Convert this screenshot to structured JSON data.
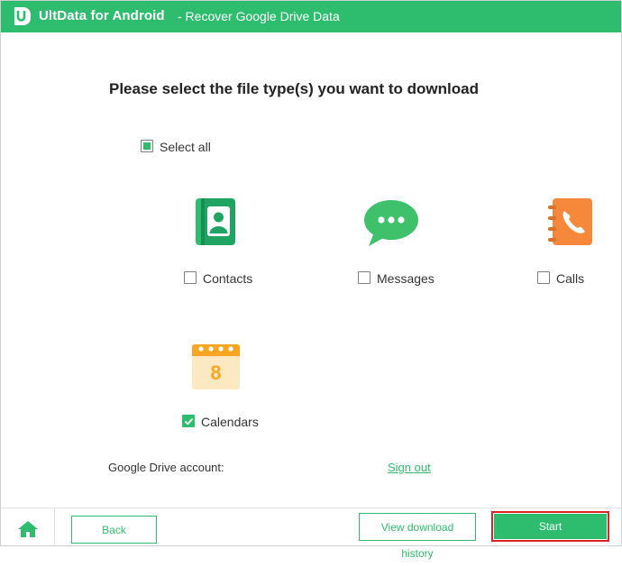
{
  "window": {
    "app_name": "UltData for Android",
    "subtitle": "- Recover Google Drive Data"
  },
  "main": {
    "heading": "Please select the file type(s) you want to download",
    "select_all": {
      "label": "Select all",
      "state": "partial"
    },
    "file_types": [
      {
        "label": "Contacts",
        "checked": false,
        "icon": "contacts-icon"
      },
      {
        "label": "Messages",
        "checked": false,
        "icon": "messages-icon"
      },
      {
        "label": "Calls",
        "checked": false,
        "icon": "calls-icon"
      },
      {
        "label": "Calendars",
        "checked": true,
        "icon": "calendars-icon",
        "calendar_day": "8"
      }
    ],
    "account": {
      "label": "Google Drive account:",
      "sign_out": "Sign out"
    }
  },
  "footer": {
    "back": "Back",
    "view_history": "View download history",
    "start": "Start"
  },
  "colors": {
    "accent": "#2ebd6e",
    "highlight_border": "#d9252a",
    "calls_orange": "#f5883a",
    "calendar_orange": "#f7a523"
  }
}
